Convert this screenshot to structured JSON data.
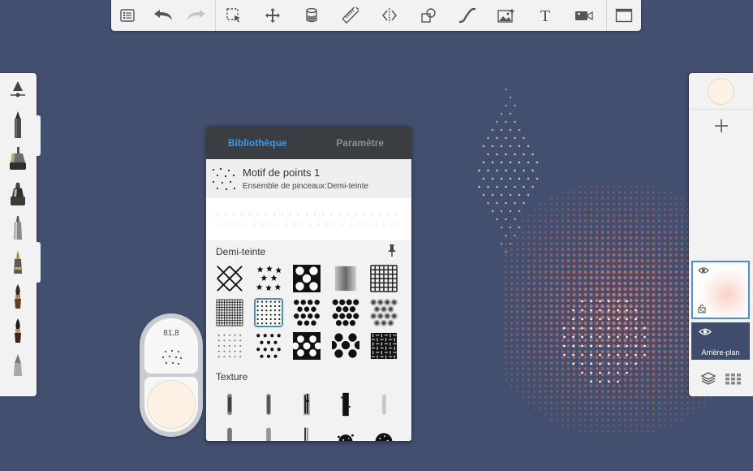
{
  "app": {
    "colors": {
      "canvas": "#424f6f",
      "toolbar": "#f2f2f2",
      "accent": "#3d9ae8",
      "halftone_orange": "#e3745f",
      "halftone_cream": "#f4dcc4"
    }
  },
  "toolbar": {
    "items": [
      {
        "icon": "list-icon"
      },
      {
        "icon": "undo-icon"
      },
      {
        "icon": "redo-icon"
      },
      {
        "icon": "select-icon"
      },
      {
        "icon": "transform-icon"
      },
      {
        "icon": "bucket-icon"
      },
      {
        "icon": "ruler-icon"
      },
      {
        "icon": "symmetry-icon"
      },
      {
        "icon": "shapes-icon"
      },
      {
        "icon": "curve-icon"
      },
      {
        "icon": "image-icon"
      },
      {
        "icon": "text-icon"
      },
      {
        "icon": "video-icon"
      },
      {
        "icon": "fullscreen-icon"
      }
    ]
  },
  "brushes": {
    "items": [
      "brush-settings-icon",
      "pencil-icon",
      "airbrush-icon",
      "marker-icon",
      "felt-pen-icon",
      "fountain-pen-icon",
      "paintbrush-icon",
      "ink-brush-icon",
      "eraser-icon"
    ]
  },
  "library": {
    "tabs": [
      {
        "label": "Bibliothèque",
        "active": true
      },
      {
        "label": "Paramètre",
        "active": false
      }
    ],
    "current_brush": {
      "name": "Motif de points 1",
      "set": "Ensemble de pinceaux:Demi-teinte"
    },
    "sections": [
      {
        "title": "Demi-teinte",
        "pinned": true,
        "items": [
          "cross-lines",
          "stars",
          "hexagons",
          "soft-squares",
          "grid",
          "fine-grid",
          "dots-sparse",
          "dots-large",
          "dots-medium",
          "soft-dots",
          "small-dots",
          "bold-dots",
          "black-hex",
          "round-dots",
          "weave"
        ],
        "selected_index": 6
      },
      {
        "title": "Texture",
        "items": [
          "smudge-1",
          "smudge-2",
          "chalk-1",
          "rough-1",
          "faint-1",
          "smudge-3",
          "smudge-4",
          "chalk-2",
          "splatter",
          "sponge"
        ]
      }
    ]
  },
  "size_opacity": {
    "size_value": "81,8",
    "color": "#fdf1e3"
  },
  "layers": {
    "items": [
      {
        "name": "",
        "visible": true,
        "locked": false
      },
      {
        "name": "Arrière-plan",
        "visible": true
      }
    ]
  }
}
